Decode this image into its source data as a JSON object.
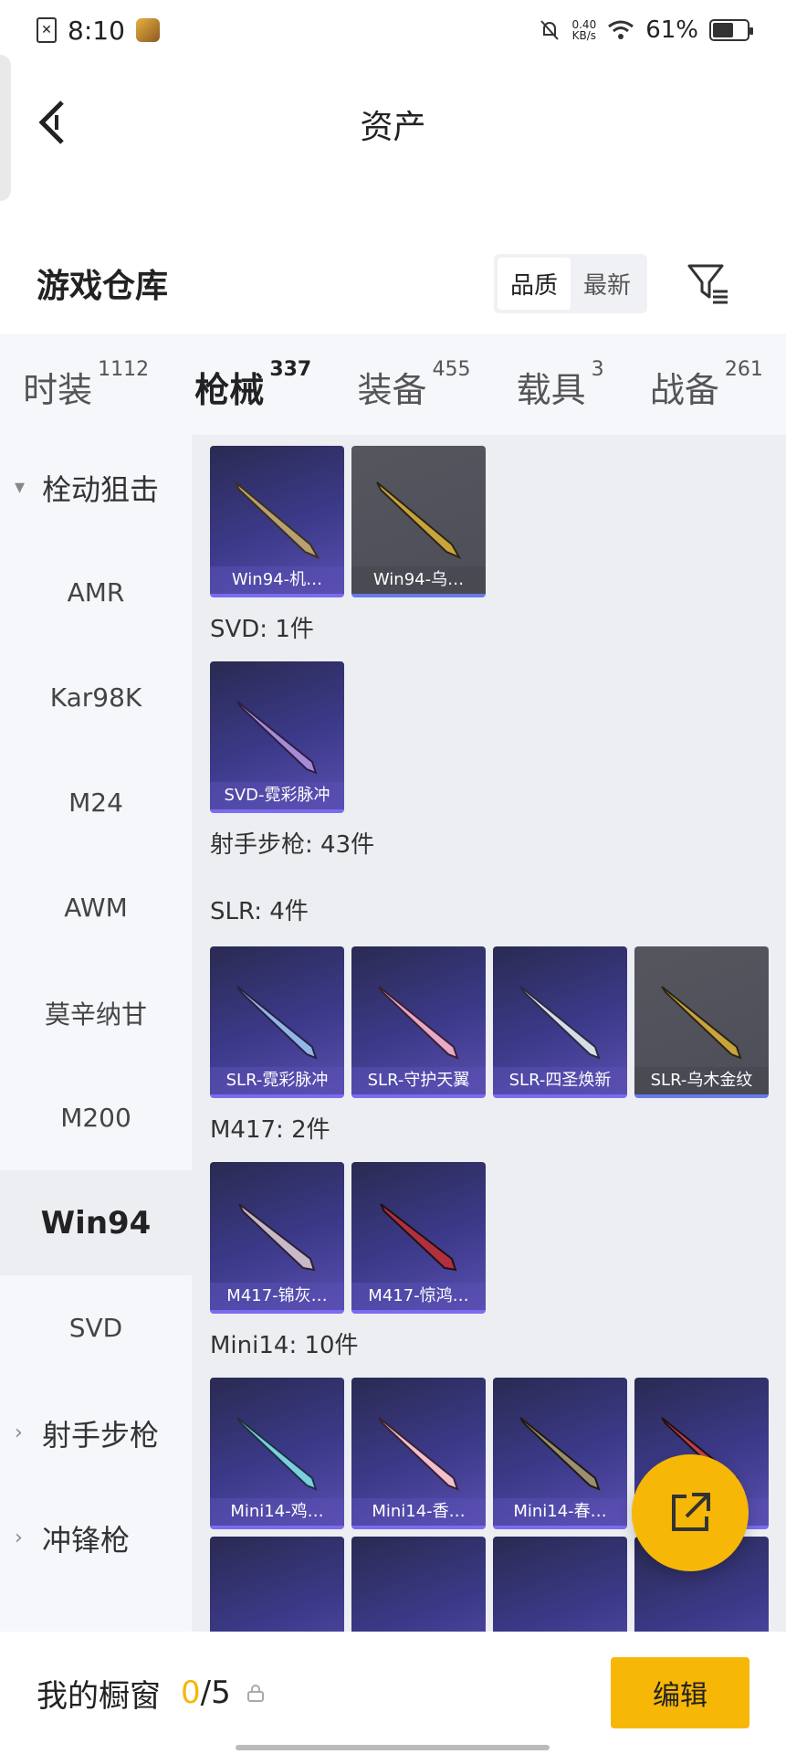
{
  "status_bar": {
    "time": "8:10",
    "net_speed_value": "0.40",
    "net_speed_unit": "KB/s",
    "battery": "61%"
  },
  "nav": {
    "title": "资产"
  },
  "warehouse": {
    "title": "游戏仓库",
    "sort_options": [
      "品质",
      "最新"
    ]
  },
  "tabs": [
    {
      "label": "时装",
      "count": "1112"
    },
    {
      "label": "枪械",
      "count": "337"
    },
    {
      "label": "装备",
      "count": "455"
    },
    {
      "label": "载具",
      "count": "3"
    },
    {
      "label": "战备",
      "count": "261"
    }
  ],
  "side_menu": [
    {
      "label": "栓动狙击",
      "type": "group",
      "chevron": "▾"
    },
    {
      "label": "AMR"
    },
    {
      "label": "Kar98K"
    },
    {
      "label": "M24"
    },
    {
      "label": "AWM"
    },
    {
      "label": "莫辛纳甘"
    },
    {
      "label": "M200"
    },
    {
      "label": "Win94",
      "selected": true
    },
    {
      "label": "SVD"
    },
    {
      "label": "射手步枪",
      "type": "group",
      "chevron": "›"
    },
    {
      "label": "冲锋枪",
      "type": "group",
      "chevron": "›"
    }
  ],
  "content": {
    "win94": [
      "Win94-机…",
      "Win94-乌…"
    ],
    "svd_label": "SVD: 1件",
    "svd": [
      "SVD-霓彩脉冲"
    ],
    "dmr_label": "射手步枪: 43件",
    "slr_label": "SLR: 4件",
    "slr": [
      "SLR-霓彩脉冲",
      "SLR-守护天翼",
      "SLR-四圣焕新",
      "SLR-乌木金纹"
    ],
    "m417_label": "M417: 2件",
    "m417": [
      "M417-锦灰…",
      "M417-惊鸿…"
    ],
    "mini14_label": "Mini14: 10件",
    "mini14": [
      "Mini14-鸡…",
      "Mini14-香…",
      "Mini14-春…",
      ""
    ]
  },
  "bottom_bar": {
    "label": "我的橱窗",
    "used": "0",
    "total": "/5",
    "edit_label": "编辑"
  },
  "colors": {
    "accent": "#f7b707",
    "card_purple": "#3c3a8a",
    "card_gray": "#55565e"
  }
}
